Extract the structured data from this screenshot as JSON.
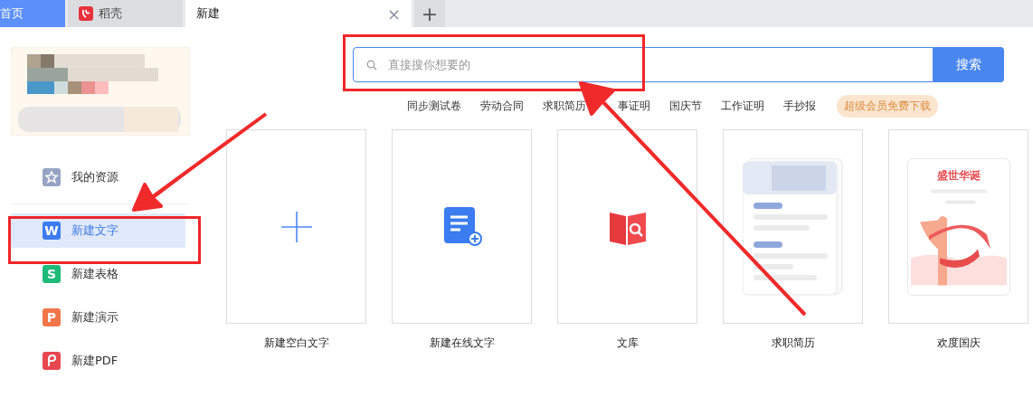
{
  "tabs": [
    {
      "label": "首页",
      "kind": "home",
      "selected": false
    },
    {
      "label": "稻壳",
      "kind": "app",
      "selected": false
    },
    {
      "label": "新建",
      "kind": "doc",
      "selected": true,
      "close": "×"
    }
  ],
  "new_tab": "+",
  "sidebar": {
    "items": [
      {
        "label": "我的资源",
        "kind": "star",
        "selected": false
      },
      {
        "label": "新建文字",
        "kind": "doc",
        "glyph": "W",
        "color": "#3b7cf0",
        "selected": true
      },
      {
        "label": "新建表格",
        "kind": "doc",
        "glyph": "S",
        "color": "#1dba79",
        "selected": false
      },
      {
        "label": "新建演示",
        "kind": "doc",
        "glyph": "P",
        "color": "#f0764a",
        "selected": false
      },
      {
        "label": "新建PDF",
        "kind": "pdf",
        "color": "#e8474f",
        "selected": false
      }
    ]
  },
  "search": {
    "placeholder": "直接搜你想要的",
    "button": "搜索"
  },
  "tags": [
    {
      "label": "同步测试卷",
      "kind": "plain"
    },
    {
      "label": "劳动合同",
      "kind": "plain"
    },
    {
      "label": "求职简历",
      "kind": "plain"
    },
    {
      "label": "事证明",
      "kind": "plain"
    },
    {
      "label": "国庆节",
      "kind": "plain"
    },
    {
      "label": "工作证明",
      "kind": "plain"
    },
    {
      "label": "手抄报",
      "kind": "plain"
    },
    {
      "label": "超级会员免费下载",
      "kind": "vip"
    }
  ],
  "cards": [
    {
      "label": "新建空白文字",
      "kind": "blank"
    },
    {
      "label": "新建在线文字",
      "kind": "online"
    },
    {
      "label": "文库",
      "kind": "library"
    },
    {
      "label": "求职简历",
      "kind": "resume"
    },
    {
      "label": "欢度国庆",
      "kind": "holiday",
      "heading": "盛世华诞"
    }
  ]
}
